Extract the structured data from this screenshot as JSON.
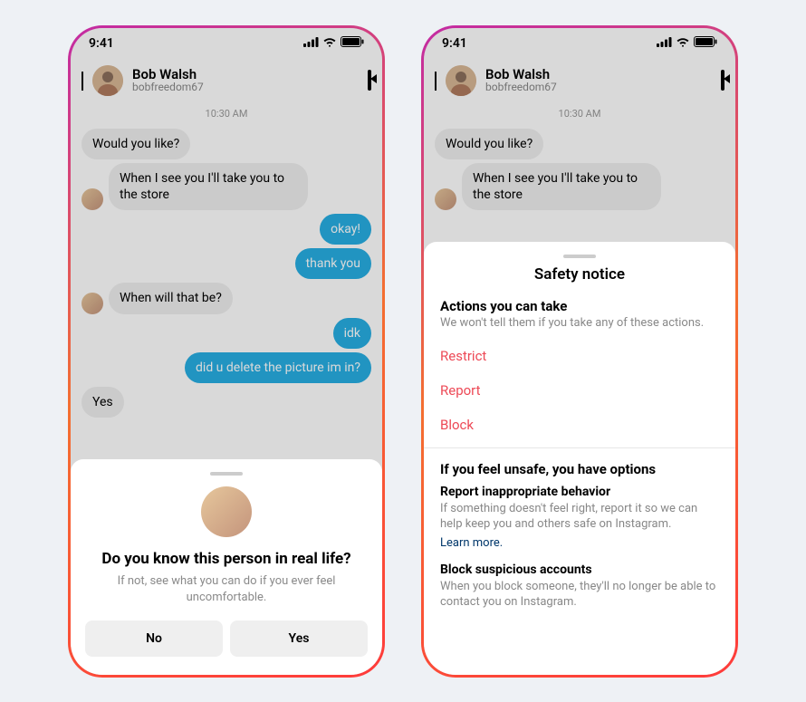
{
  "status": {
    "time": "9:41"
  },
  "header": {
    "display_name": "Bob Walsh",
    "username": "bobfreedom67"
  },
  "chat": {
    "timestamp": "10:30 AM",
    "messages": {
      "m1": "Would you like?",
      "m2": "When I see you I'll take you to the store",
      "m3": "okay!",
      "m4": "thank you",
      "m5": "When will that be?",
      "m6": "idk",
      "m7": "did u delete the picture im in?",
      "m8": "Yes"
    }
  },
  "sheet1": {
    "title": "Do you know this person in real life?",
    "subtitle": "If not, see what you can do if you ever feel uncomfortable.",
    "no_label": "No",
    "yes_label": "Yes"
  },
  "sheet2": {
    "title": "Safety notice",
    "actions_heading": "Actions you can take",
    "actions_sub": "We won't tell them if you take any of these actions.",
    "restrict": "Restrict",
    "report": "Report",
    "block": "Block",
    "unsafe_heading": "If you feel unsafe, you have options",
    "p1_head": "Report inappropriate behavior",
    "p1_body": "If something doesn't feel right, report it so we can help keep you and others safe on Instagram.",
    "learn_more": "Learn more.",
    "p2_head": "Block suspicious accounts",
    "p2_body": "When you block someone, they'll no longer be able to contact you on Instagram."
  },
  "colors": {
    "danger": "#ed4956",
    "sent_bubble": "#27aee3",
    "link": "#00376b"
  }
}
